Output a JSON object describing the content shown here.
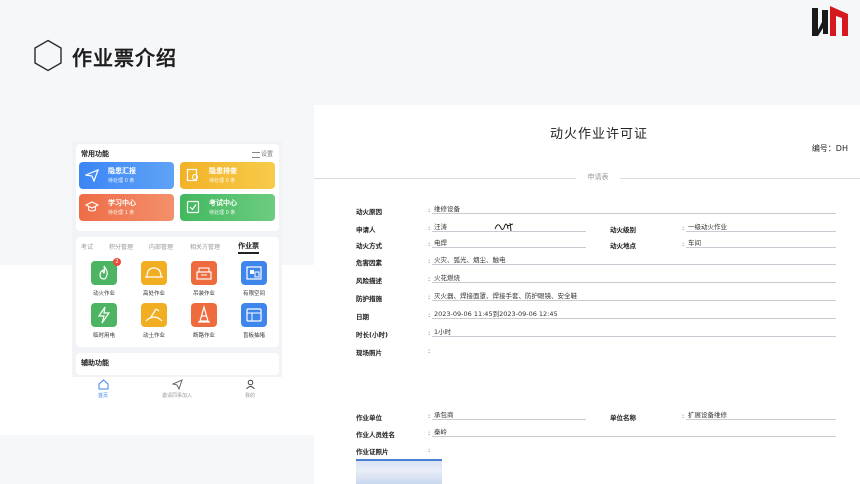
{
  "slide": {
    "title": "作业票介绍"
  },
  "phone": {
    "common_title": "常用功能",
    "settings_label": "设置",
    "tiles": [
      {
        "label": "隐患汇报",
        "sub": "待处理 0 条",
        "icon": "paper-plane-icon",
        "color": "#3c86f5"
      },
      {
        "label": "隐患排查",
        "sub": "待处理 0 条",
        "icon": "inspect-icon",
        "color": "#f2b227"
      },
      {
        "label": "学习中心",
        "sub": "待处理 1 条",
        "icon": "graduation-cap-icon",
        "color": "#ee6d47"
      },
      {
        "label": "考试中心",
        "sub": "待处理 0 条",
        "icon": "checkbox-icon",
        "color": "#43b85f"
      }
    ],
    "tabs": [
      "考试",
      "积分管理",
      "内部管理",
      "相关方管理",
      "作业票"
    ],
    "active_tab": "作业票",
    "apps": [
      {
        "label": "动火作业",
        "icon": "fire-work-icon",
        "color": "#4cb462",
        "badge": "2"
      },
      {
        "label": "高处作业",
        "icon": "hard-hat-icon",
        "color": "#f1ae22"
      },
      {
        "label": "吊装作业",
        "icon": "crane-icon",
        "color": "#ee6b3e"
      },
      {
        "label": "有限空间",
        "icon": "confined-space-icon",
        "color": "#3e86ec"
      },
      {
        "label": "临时用电",
        "icon": "lightning-icon",
        "color": "#4cb462"
      },
      {
        "label": "动土作业",
        "icon": "excavation-icon",
        "color": "#f1ae22"
      },
      {
        "label": "断路作业",
        "icon": "roadblock-icon",
        "color": "#ee6b3e"
      },
      {
        "label": "盲板抽堵",
        "icon": "blind-plate-icon",
        "color": "#3e86ec"
      }
    ],
    "aux_title": "辅助功能",
    "nav": [
      {
        "label": "首页",
        "icon": "home-icon"
      },
      {
        "label": "邀请同事加入",
        "icon": "send-icon"
      },
      {
        "label": "我的",
        "icon": "user-icon"
      }
    ]
  },
  "permit": {
    "title": "动火作业许可证",
    "number": "编号：DH",
    "section": "申请表",
    "fields": {
      "reason": {
        "label": "动火原因",
        "value": "维修设备"
      },
      "applicant": {
        "label": "申请人",
        "value": "汪涛"
      },
      "level": {
        "label": "动火级别",
        "value": "一级动火作业"
      },
      "method": {
        "label": "动火方式",
        "value": "电焊"
      },
      "location": {
        "label": "动火地点",
        "value": "车间"
      },
      "hazards": {
        "label": "危害因素",
        "value": "火灾、弧光、烟尘、触电"
      },
      "risk": {
        "label": "风险描述",
        "value": "火花燃烧"
      },
      "protection": {
        "label": "防护措施",
        "value": "灭火器、焊接面罩、焊接手套、防护眼镜、安全鞋"
      },
      "date": {
        "label": "日期",
        "value": "2023-09-06 11:45到2023-09-06 12:45"
      },
      "duration": {
        "label": "时长(小时)",
        "value": "1小时"
      },
      "photos": {
        "label": "现场照片",
        "value": ""
      },
      "work_unit": {
        "label": "作业单位",
        "value": "承包商"
      },
      "unit_name": {
        "label": "单位名称",
        "value": "扩展设备维修"
      },
      "worker": {
        "label": "作业人员姓名",
        "value": "秦岭"
      },
      "cert_photo": {
        "label": "作业证照片",
        "value": ""
      }
    }
  },
  "colors": {
    "brand_red": "#d5191f",
    "primary_blue": "#3e86ec"
  }
}
